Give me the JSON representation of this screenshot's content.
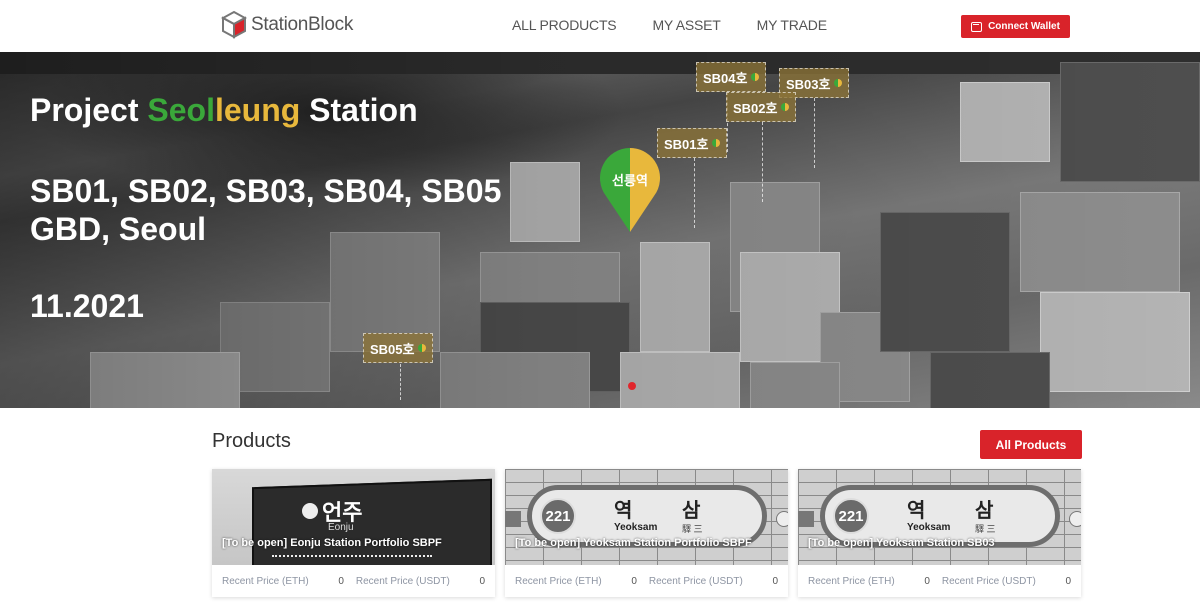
{
  "header": {
    "logo_text": "StationBlock",
    "nav": [
      "ALL PRODUCTS",
      "MY ASSET",
      "MY TRADE"
    ],
    "connect_wallet_label": "Connect Wallet",
    "accent_color": "#d9232a"
  },
  "hero": {
    "title_prefix": "Project ",
    "title_green": "Seol",
    "title_yellow": "leung",
    "title_suffix": " Station",
    "lots_line": "SB01, SB02, SB03, SB04, SB05",
    "location_line": "GBD, Seoul",
    "date": "11.2021",
    "station_pin_label": "선릉역",
    "tags": [
      "SB01호",
      "SB02호",
      "SB03호",
      "SB04호",
      "SB05호"
    ],
    "colors": {
      "green": "#3aa83a",
      "yellow": "#e8b83c"
    }
  },
  "products": {
    "title": "Products",
    "all_products_label": "All Products",
    "cards": [
      {
        "name": "[To be open] Eonju Station Portfolio SBPF",
        "sign_ko": "언주",
        "sign_en": "Eonju",
        "eth_label": "Recent Price (ETH)",
        "eth_value": "0",
        "usdt_label": "Recent Price (USDT)",
        "usdt_value": "0"
      },
      {
        "name": "[To be open] Yeoksam Station Portfolio SBPF",
        "sign_num": "221",
        "sign_ko1": "역",
        "sign_ko2": "삼",
        "sign_en": "Yeoksam",
        "sign_hanja": "驛 三",
        "eth_label": "Recent Price (ETH)",
        "eth_value": "0",
        "usdt_label": "Recent Price (USDT)",
        "usdt_value": "0"
      },
      {
        "name": "[To be open] Yeoksam Station SB03",
        "sign_num": "221",
        "sign_ko1": "역",
        "sign_ko2": "삼",
        "sign_en": "Yeoksam",
        "sign_hanja": "驛 三",
        "eth_label": "Recent Price (ETH)",
        "eth_value": "0",
        "usdt_label": "Recent Price (USDT)",
        "usdt_value": "0"
      }
    ]
  }
}
